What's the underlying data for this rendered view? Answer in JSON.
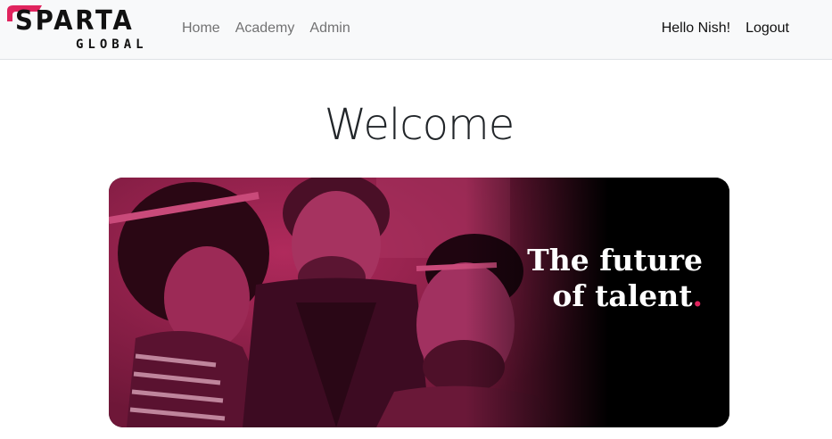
{
  "brand": {
    "name": "SPARTA",
    "subname": "GLOBAL",
    "accent_color": "#e0245e"
  },
  "nav": {
    "links": [
      {
        "label": "Home"
      },
      {
        "label": "Academy"
      },
      {
        "label": "Admin"
      }
    ],
    "greeting": "Hello Nish!",
    "logout_label": "Logout"
  },
  "main": {
    "title": "Welcome",
    "banner": {
      "line1": "The future",
      "line2": "of talent",
      "dot": ".",
      "image_tint": "#8e1f4a"
    }
  }
}
